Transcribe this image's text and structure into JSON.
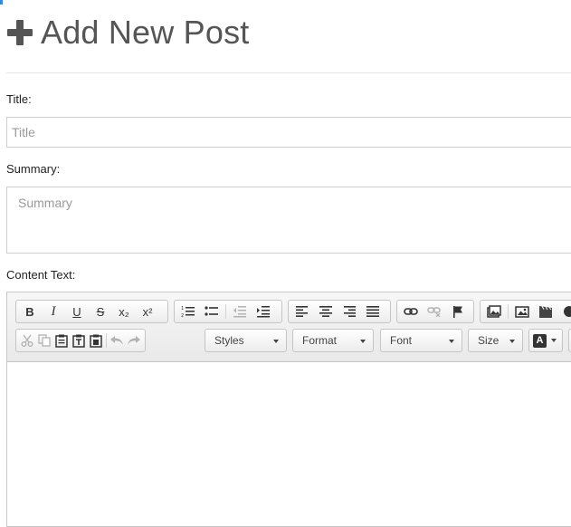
{
  "header": {
    "title": "Add New Post",
    "icon": "plus-icon"
  },
  "form": {
    "title_label": "Title:",
    "title_placeholder": "Title",
    "summary_label": "Summary:",
    "summary_placeholder": "Summary",
    "content_label": "Content Text:"
  },
  "editor": {
    "bold": "B",
    "italic": "I",
    "underline": "U",
    "strike": "S",
    "subscript": "x₂",
    "superscript": "x²",
    "styles": "Styles",
    "format": "Format",
    "font": "Font",
    "size": "Size",
    "text_color": "A"
  },
  "colors": {
    "accent": "#3a87d6",
    "title": "#555555"
  }
}
